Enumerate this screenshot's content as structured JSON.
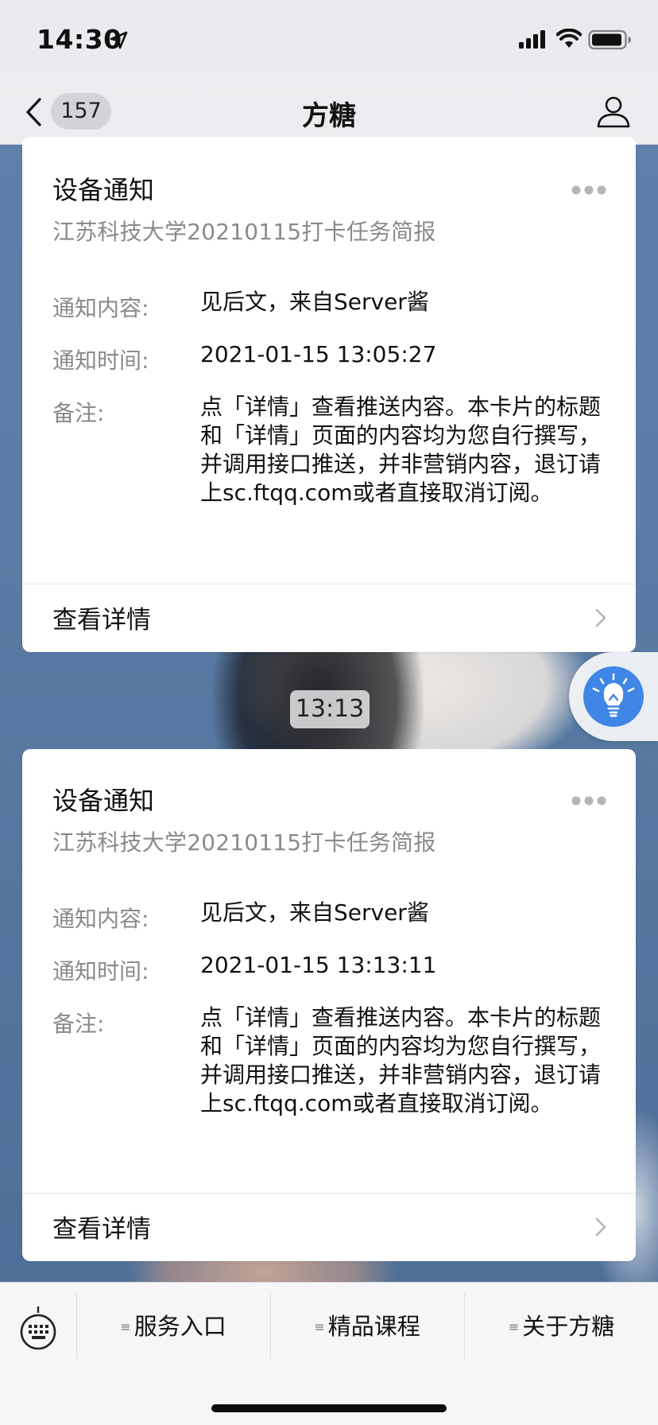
{
  "status_bar": {
    "time": "14:30"
  },
  "nav": {
    "badge_count": "157",
    "title": "方糖"
  },
  "cards": [
    {
      "title": "设备通知",
      "subtitle": "江苏科技大学20210115打卡任务简报",
      "rows": [
        {
          "label": "通知内容:",
          "value": "见后文，来自Server酱"
        },
        {
          "label": "通知时间:",
          "value": "2021-01-15 13:05:27"
        },
        {
          "label": "备注:",
          "value": "点「详情」查看推送内容。本卡片的标题和「详情」页面的内容均为您自行撰写，并调用接口推送，并非营销内容，退订请上sc.ftqq.com或者直接取消订阅。"
        }
      ],
      "detail_label": "查看详情"
    },
    {
      "title": "设备通知",
      "subtitle": "江苏科技大学20210115打卡任务简报",
      "rows": [
        {
          "label": "通知内容:",
          "value": "见后文，来自Server酱"
        },
        {
          "label": "通知时间:",
          "value": "2021-01-15 13:13:11"
        },
        {
          "label": "备注:",
          "value": "点「详情」查看推送内容。本卡片的标题和「详情」页面的内容均为您自行撰写，并调用接口推送，并非营销内容，退订请上sc.ftqq.com或者直接取消订阅。"
        }
      ],
      "detail_label": "查看详情"
    }
  ],
  "timestamp_divider": "13:13",
  "bottom_menu": {
    "items": [
      {
        "label": "服务入口"
      },
      {
        "label": "精品课程"
      },
      {
        "label": "关于方糖"
      }
    ]
  },
  "colors": {
    "accent_blue": "#3f86e6",
    "secondary_text": "#8a8a8e"
  },
  "icons": [
    "location-arrow-icon",
    "cellular-signal-icon",
    "wifi-icon",
    "battery-icon",
    "back-chevron-icon",
    "profile-icon",
    "more-dots-icon",
    "chevron-right-icon",
    "lightbulb-icon",
    "keyboard-icon"
  ]
}
